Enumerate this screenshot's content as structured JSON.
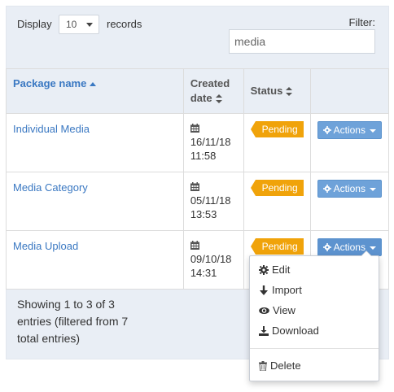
{
  "controls": {
    "display_label": "Display",
    "length_value": "10",
    "records_label": "records",
    "filter_label": "Filter:",
    "filter_value": "media"
  },
  "table": {
    "headers": {
      "name": "Package name",
      "date_line1": "Created",
      "date_line2": "date",
      "status": "Status"
    },
    "rows": [
      {
        "name": "Individual Media",
        "date": "16/11/18",
        "time": "11:58",
        "status": "Pending",
        "action": "Actions"
      },
      {
        "name": "Media Category",
        "date": "05/11/18",
        "time": "13:53",
        "status": "Pending",
        "action": "Actions"
      },
      {
        "name": "Media Upload",
        "date": "09/10/18",
        "time": "14:31",
        "status": "Pending",
        "action": "Actions"
      }
    ]
  },
  "info": {
    "line1": "Showing 1 to 3 of 3",
    "line2": "entries (filtered from 7",
    "line3": "total entries)"
  },
  "dropdown": {
    "edit": "Edit",
    "import": "Import",
    "view": "View",
    "download": "Download",
    "delete": "Delete"
  },
  "colors": {
    "link": "#3a78c2",
    "pending": "#f0a30a",
    "actions_button": "#6ea2d9",
    "panel": "#e9eef5"
  }
}
